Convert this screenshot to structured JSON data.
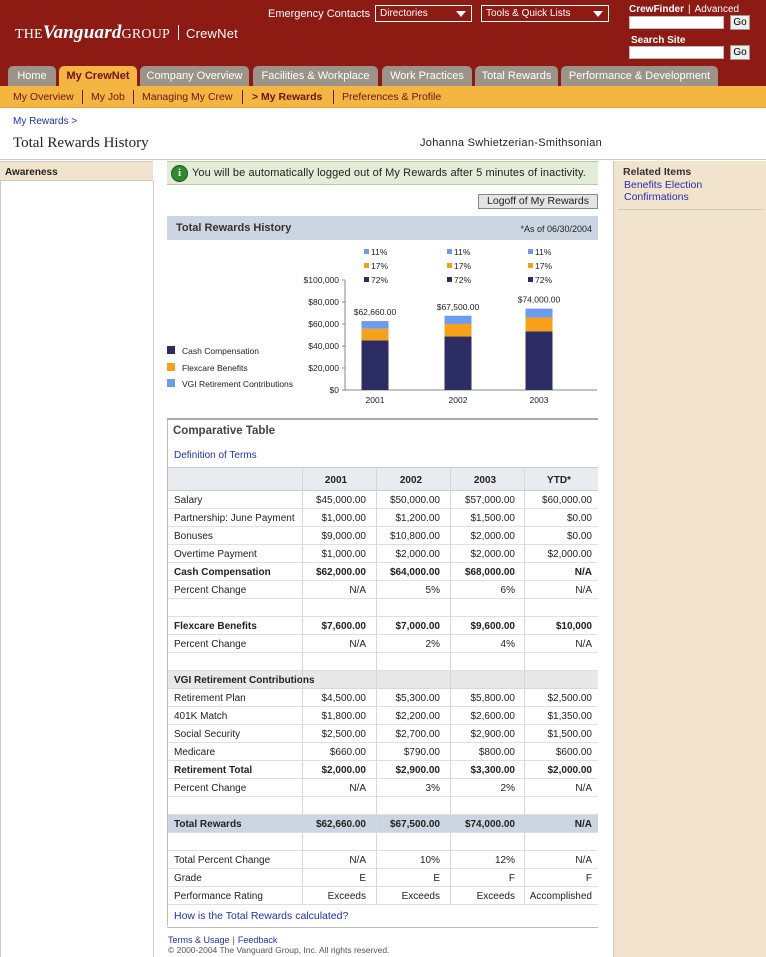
{
  "header": {
    "logo_pre": "THE",
    "logo_main": "Vanguard",
    "logo_post": "GROUP",
    "site_name": "CrewNet",
    "emergency_contacts": "Emergency Contacts",
    "directories": "Directories",
    "tools": "Tools & Quick Lists",
    "crewfinder": "CrewFinder",
    "advanced": "Advanced",
    "search_site": "Search Site",
    "go": "Go"
  },
  "tabs": [
    {
      "label": "Home"
    },
    {
      "label": "My CrewNet"
    },
    {
      "label": "Company Overview"
    },
    {
      "label": "Facilities & Workplace"
    },
    {
      "label": "Work Practices"
    },
    {
      "label": "Total Rewards"
    },
    {
      "label": "Performance & Development"
    }
  ],
  "subnav": [
    {
      "label": "My Overview"
    },
    {
      "label": "My Job"
    },
    {
      "label": "Managing My Crew"
    },
    {
      "label": "> My Rewards"
    },
    {
      "label": "Preferences & Profile"
    }
  ],
  "breadcrumb": "My Rewards >",
  "page_title": "Total Rewards History",
  "user_name": "Johanna Swhietzerian-Smithsonian",
  "left": {
    "awareness": "Awareness"
  },
  "notice": {
    "icon": "i",
    "text": "You will be automatically logged out of My Rewards after 5 minutes of inactivity."
  },
  "logoff": "Logoff of My Rewards",
  "history": {
    "title": "Total Rewards History",
    "as_of": "*As of 06/30/2004"
  },
  "chart_data": {
    "type": "bar",
    "stacked": true,
    "categories": [
      "2001",
      "2002",
      "2003"
    ],
    "series": [
      {
        "name": "Cash Compensation",
        "color": "#2b2d63",
        "values": [
          45115.2,
          48600,
          53280
        ],
        "pct": [
          "72%",
          "72%",
          "72%"
        ]
      },
      {
        "name": "Flexcare Benefits",
        "color": "#f7a11a",
        "values": [
          10652.2,
          11475,
          12580
        ],
        "pct": [
          "17%",
          "17%",
          "17%"
        ]
      },
      {
        "name": "VGI Retirement Contributions",
        "color": "#6d9bf0",
        "values": [
          6892.6,
          7425,
          8140
        ],
        "pct": [
          "11%",
          "11%",
          "11%"
        ]
      }
    ],
    "totals": [
      "$62,660.00",
      "$67,500.00",
      "$74,000.00"
    ],
    "y_ticks": [
      "$0",
      "$20,000",
      "$40,000",
      "$60,000",
      "$80,000",
      "$100,000"
    ],
    "ylim": [
      0,
      100000
    ],
    "legend_position": "left"
  },
  "comparative": {
    "title": "Comparative Table",
    "definition_link": "Definition of Terms",
    "columns": [
      "",
      "2001",
      "2002",
      "2003",
      "YTD*"
    ],
    "rows": [
      {
        "type": "data",
        "cells": [
          "Salary",
          "$45,000.00",
          "$50,000.00",
          "$57,000.00",
          "$60,000.00"
        ]
      },
      {
        "type": "data",
        "cells": [
          "Partnership: June Payment",
          "$1,000.00",
          "$1,200.00",
          "$1,500.00",
          "$0.00"
        ]
      },
      {
        "type": "data",
        "cells": [
          "Bonuses",
          "$9,000.00",
          "$10,800.00",
          "$2,000.00",
          "$0.00"
        ]
      },
      {
        "type": "data",
        "cells": [
          "Overtime Payment",
          "$1,000.00",
          "$2,000.00",
          "$2,000.00",
          "$2,000.00"
        ]
      },
      {
        "type": "bold",
        "cells": [
          "Cash Compensation",
          "$62,000.00",
          "$64,000.00",
          "$68,000.00",
          "N/A"
        ]
      },
      {
        "type": "data",
        "cells": [
          "Percent Change",
          "N/A",
          "5%",
          "6%",
          "N/A"
        ]
      },
      {
        "type": "spacer",
        "cells": [
          "",
          "",
          "",
          "",
          ""
        ]
      },
      {
        "type": "bold",
        "cells": [
          "Flexcare Benefits",
          "$7,600.00",
          "$7,000.00",
          "$9,600.00",
          "$10,000"
        ]
      },
      {
        "type": "data",
        "cells": [
          "Percent Change",
          "N/A",
          "2%",
          "4%",
          "N/A"
        ]
      },
      {
        "type": "spacer",
        "cells": [
          "",
          "",
          "",
          "",
          ""
        ]
      },
      {
        "type": "sechead",
        "cells": [
          "VGI Retirement Contributions",
          "",
          "",
          "",
          ""
        ]
      },
      {
        "type": "data",
        "cells": [
          "Retirement Plan",
          "$4,500.00",
          "$5,300.00",
          "$5,800.00",
          "$2,500.00"
        ]
      },
      {
        "type": "data",
        "cells": [
          "401K Match",
          "$1,800.00",
          "$2,200.00",
          "$2,600.00",
          "$1,350.00"
        ]
      },
      {
        "type": "data",
        "cells": [
          "Social Security",
          "$2,500.00",
          "$2,700.00",
          "$2,900.00",
          "$1,500.00"
        ]
      },
      {
        "type": "data",
        "cells": [
          "Medicare",
          "$660.00",
          "$790.00",
          "$800.00",
          "$600.00"
        ]
      },
      {
        "type": "bold",
        "cells": [
          "Retirement Total",
          "$2,000.00",
          "$2,900.00",
          "$3,300.00",
          "$2,000.00"
        ]
      },
      {
        "type": "data",
        "cells": [
          "Percent Change",
          "N/A",
          "3%",
          "2%",
          "N/A"
        ]
      },
      {
        "type": "spacer",
        "cells": [
          "",
          "",
          "",
          "",
          ""
        ]
      },
      {
        "type": "total",
        "cells": [
          "Total Rewards",
          "$62,660.00",
          "$67,500.00",
          "$74,000.00",
          "N/A"
        ]
      },
      {
        "type": "spacer",
        "cells": [
          "",
          "",
          "",
          "",
          ""
        ]
      },
      {
        "type": "data",
        "cells": [
          "Total Percent Change",
          "N/A",
          "10%",
          "12%",
          "N/A"
        ]
      },
      {
        "type": "data",
        "cells": [
          "Grade",
          "E",
          "E",
          "F",
          "F"
        ]
      },
      {
        "type": "data",
        "cells": [
          "Performance Rating",
          "Exceeds",
          "Exceeds",
          "Exceeds",
          "Accomplished"
        ]
      }
    ],
    "calc_link": "How is the Total Rewards calculated?"
  },
  "footer": {
    "terms": "Terms & Usage",
    "sep": "|",
    "feedback": "Feedback",
    "copyright": "© 2000-2004 The Vanguard Group, Inc. All rights reserved."
  },
  "related": {
    "title": "Related Items",
    "links": [
      "Benefits Election",
      "Confirmations"
    ]
  }
}
